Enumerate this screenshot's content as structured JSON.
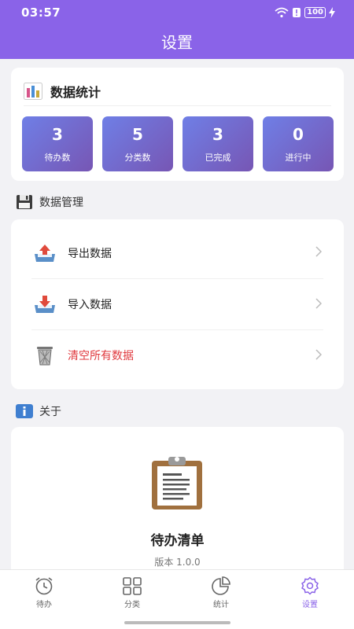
{
  "status_bar": {
    "time": "03:57",
    "battery": "100"
  },
  "nav": {
    "title": "设置"
  },
  "stats": {
    "title": "数据统计",
    "tiles": [
      {
        "value": "3",
        "label": "待办数"
      },
      {
        "value": "5",
        "label": "分类数"
      },
      {
        "value": "3",
        "label": "已完成"
      },
      {
        "value": "0",
        "label": "进行中"
      }
    ]
  },
  "data_section": {
    "title": "数据管理",
    "items": [
      {
        "label": "导出数据",
        "icon": "export-icon"
      },
      {
        "label": "导入数据",
        "icon": "import-icon"
      },
      {
        "label": "清空所有数据",
        "icon": "trash-icon",
        "color": "#e0393e"
      }
    ]
  },
  "about_section": {
    "title": "关于",
    "app_name": "待办清单",
    "version": "版本 1.0.0"
  },
  "tabbar": {
    "tabs": [
      {
        "label": "待办",
        "icon": "alarm-clock-icon"
      },
      {
        "label": "分类",
        "icon": "grid-icon"
      },
      {
        "label": "统计",
        "icon": "pie-chart-icon"
      },
      {
        "label": "设置",
        "icon": "gear-icon",
        "active": true
      }
    ]
  },
  "colors": {
    "primary": "#8a63e8",
    "danger": "#e0393e",
    "tile_from": "#6f7fe6",
    "tile_to": "#7756b4"
  }
}
